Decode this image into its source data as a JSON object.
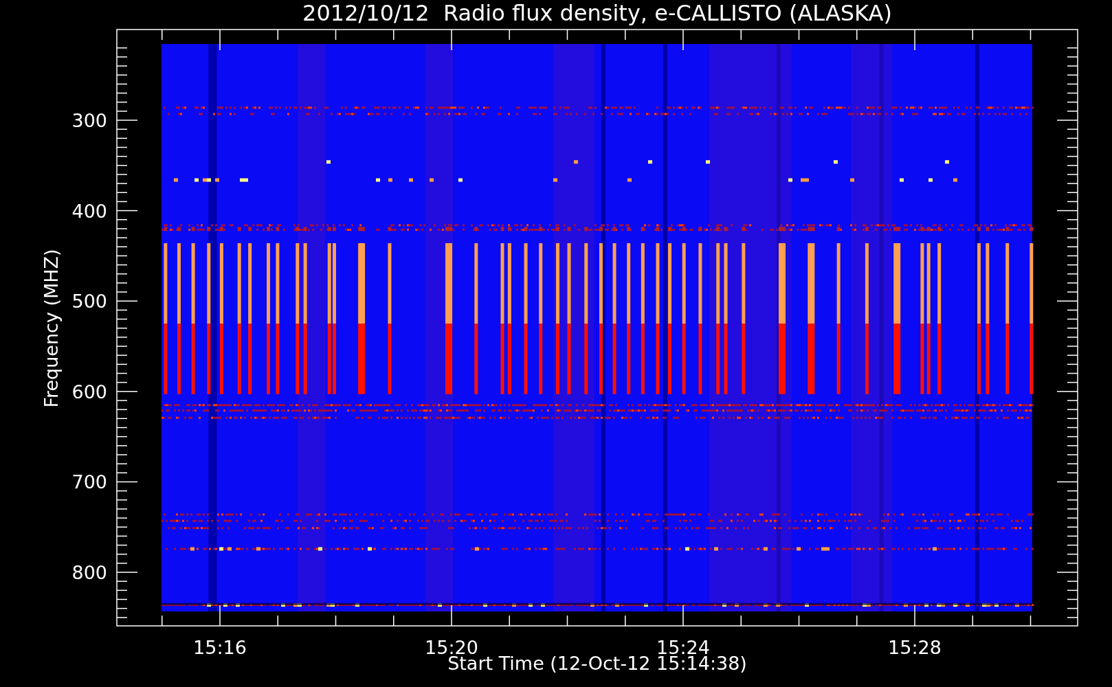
{
  "chart": {
    "title": "2012/10/12  Radio flux density, e-CALLISTO (ALASKA)",
    "ylabel": "Frequency (MHZ)",
    "xlabel": "Start Time (12-Oct-12 15:14:38)",
    "yticks": [
      "300",
      "400",
      "500",
      "600",
      "700",
      "800"
    ],
    "xticks": [
      "15:16",
      "15:20",
      "15:24",
      "15:28"
    ]
  }
}
